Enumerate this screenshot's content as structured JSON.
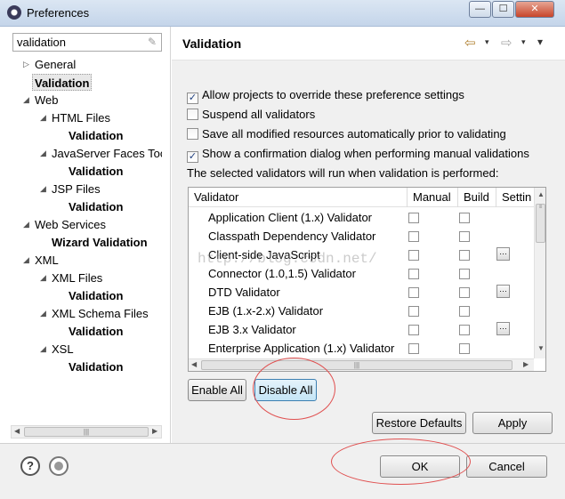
{
  "window": {
    "title": "Preferences",
    "min_glyph": "—",
    "max_glyph": "☐",
    "close_glyph": "✕"
  },
  "filter": {
    "value": "validation",
    "clear_glyph": "✎"
  },
  "tree": {
    "general": "General",
    "general_validation": "Validation",
    "web": "Web",
    "html_files": "HTML Files",
    "html_validation": "Validation",
    "jsf": "JavaServer Faces Toc",
    "jsf_validation": "Validation",
    "jsp_files": "JSP Files",
    "jsp_validation": "Validation",
    "web_services": "Web Services",
    "wizard_validation": "Wizard Validation",
    "xml": "XML",
    "xml_files": "XML Files",
    "xml_files_validation": "Validation",
    "xml_schema": "XML Schema Files",
    "xml_schema_validation": "Validation",
    "xsl": "XSL",
    "xsl_validation": "Validation"
  },
  "page": {
    "title": "Validation"
  },
  "options": {
    "allow_override": {
      "label": "Allow projects to override these preference settings",
      "checked": true
    },
    "suspend_all": {
      "label": "Suspend all validators",
      "checked": false
    },
    "save_all": {
      "label": "Save all modified resources automatically prior to validating",
      "checked": false
    },
    "show_confirm": {
      "label": "Show a confirmation dialog when performing manual validations",
      "checked": true
    }
  },
  "info_text": "The selected validators will run when validation is performed:",
  "table": {
    "headers": {
      "validator": "Validator",
      "manual": "Manual",
      "build": "Build",
      "settings": "Settin"
    },
    "rows": [
      {
        "name": "Application Client (1.x) Validator",
        "has_settings": false
      },
      {
        "name": "Classpath Dependency Validator",
        "has_settings": false
      },
      {
        "name": "Client-side JavaScript",
        "has_settings": true
      },
      {
        "name": "Connector (1.0,1.5) Validator",
        "has_settings": false
      },
      {
        "name": "DTD Validator",
        "has_settings": true
      },
      {
        "name": "EJB (1.x-2.x) Validator",
        "has_settings": false
      },
      {
        "name": "EJB 3.x Validator",
        "has_settings": true
      },
      {
        "name": "Enterprise Application (1.x) Validator",
        "has_settings": false
      }
    ],
    "settings_glyph": "…"
  },
  "buttons": {
    "enable_all": "Enable All",
    "disable_all": "Disable All",
    "restore_defaults": "Restore Defaults",
    "apply": "Apply",
    "ok": "OK",
    "cancel": "Cancel"
  },
  "watermark": "http://blog.csdn.net/",
  "icons": {
    "help": "?",
    "back": "⇦",
    "forward": "⇨",
    "dropdown": "▾",
    "menu": "▾"
  },
  "colors": {
    "annotation_ellipse": "#e05050",
    "check": "#1f3f7f"
  }
}
